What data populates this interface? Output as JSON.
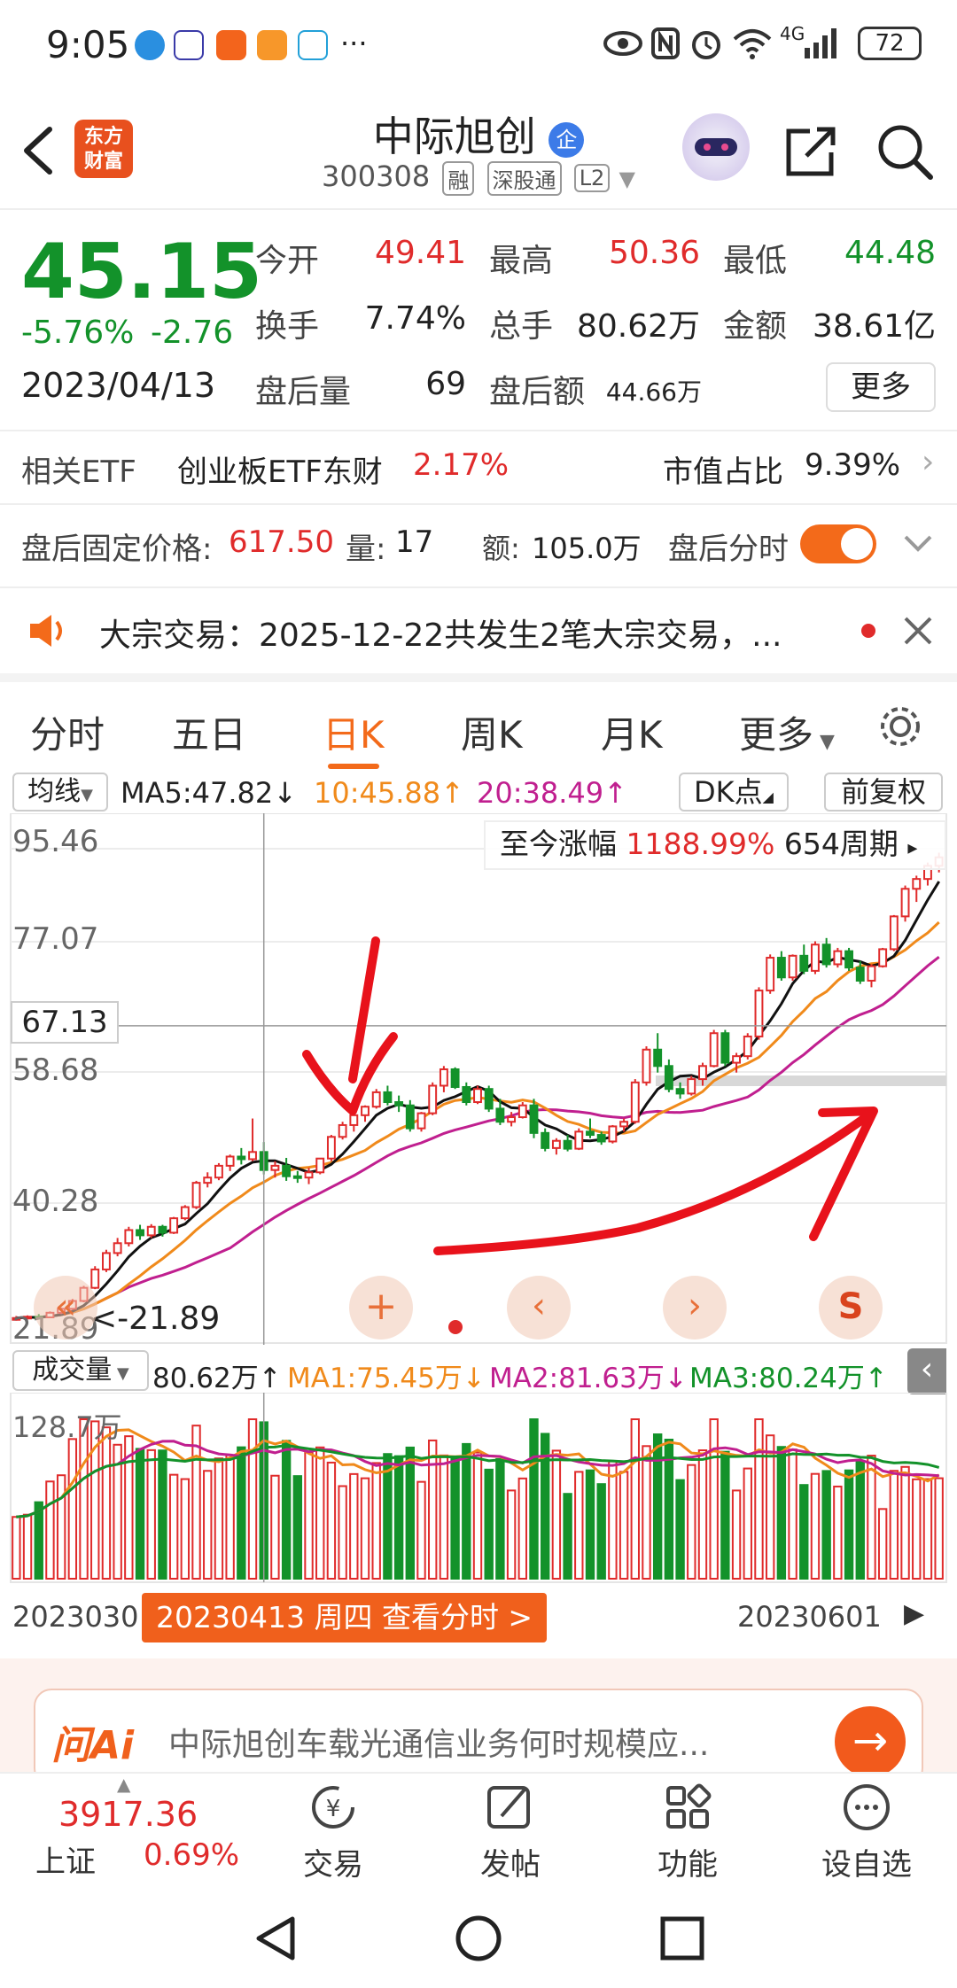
{
  "status_bar": {
    "time": "9:05",
    "more": "···",
    "network": "4G",
    "battery": "72"
  },
  "header": {
    "logo_text_line1": "东方",
    "logo_text_line2": "财富",
    "stock_name": "中际旭创",
    "stock_badge": "企",
    "stock_code": "300308",
    "tags": [
      "融",
      "深股通",
      "L2"
    ]
  },
  "quote": {
    "price": "45.15",
    "change_pct": "-5.76%",
    "change_abs": "-2.76",
    "date": "2023/04/13",
    "fields": [
      {
        "label": "今开",
        "value": "49.41",
        "color": "#e02b2b"
      },
      {
        "label": "最高",
        "value": "50.36",
        "color": "#e02b2b"
      },
      {
        "label": "最低",
        "value": "44.48",
        "color": "#13922a"
      },
      {
        "label": "换手",
        "value": "7.74%",
        "color": "#222222"
      },
      {
        "label": "总手",
        "value": "80.62万",
        "color": "#222222"
      },
      {
        "label": "金额",
        "value": "38.61亿",
        "color": "#222222"
      },
      {
        "label": "盘后量",
        "value": "69",
        "color": "#222222"
      },
      {
        "label": "盘后额",
        "value": "44.66万",
        "color": "#222222"
      }
    ],
    "more_button": "更多"
  },
  "etf": {
    "label": "相关ETF",
    "name": "创业板ETF东财",
    "pct": "2.17%",
    "market_cap_label": "市值占比",
    "market_cap_value": "9.39%"
  },
  "after_hours": {
    "fixed_price_label": "盘后固定价格:",
    "fixed_price": "617.50",
    "volume_label": "量:",
    "volume": "17",
    "amount_label": "额:",
    "amount": "105.0万",
    "timeshare_label": "盘后分时",
    "toggle_on": true
  },
  "notice": {
    "text": "大宗交易：2025-12-22共发生2笔大宗交易，..."
  },
  "tabs": {
    "items": [
      "分时",
      "五日",
      "日K",
      "周K",
      "月K",
      "更多"
    ],
    "active_index": 2
  },
  "ma_row": {
    "selector": "均线",
    "ma5": "MA5:47.82↓",
    "ma10": "10:45.88↑",
    "ma20": "20:38.49↑",
    "dk_button": "DK点",
    "restore_button": "前复权"
  },
  "chart": {
    "y_labels": [
      "95.46",
      "77.07",
      "58.68",
      "40.28",
      "21.89"
    ],
    "crosshair_value": "67.13",
    "low_marker": "21.89",
    "gain_label": "至今涨幅",
    "gain_value": "1188.99%",
    "period": "654周期",
    "colors": {
      "up": "#e02b2b",
      "down": "#13922a",
      "ma5": "#111111",
      "ma10": "#f08a1b",
      "ma20": "#c01f8f",
      "annotation": "#e8121b"
    }
  },
  "volume": {
    "selector": "成交量",
    "vol": "80.62万↑",
    "ma1": "MA1:75.45万↓",
    "ma2": "MA2:81.63万↓",
    "ma3": "MA3:80.24万↑",
    "max_label": "128.7万",
    "date_left": "2023030",
    "date_right": "20230601",
    "cursor_label": "20230413 周四 查看分时 >"
  },
  "chart_data": {
    "type": "candlestick",
    "title": "中际旭创 日K",
    "ylim": [
      21.89,
      95.46
    ],
    "ohlc": [
      [
        22.5,
        22.9,
        22.2,
        22.6
      ],
      [
        22.6,
        23.0,
        22.4,
        22.8
      ],
      [
        22.8,
        23.2,
        22.5,
        22.7
      ],
      [
        22.7,
        23.6,
        22.6,
        23.4
      ],
      [
        23.4,
        24.2,
        23.2,
        24.0
      ],
      [
        24.0,
        25.5,
        23.8,
        25.2
      ],
      [
        25.2,
        27.5,
        25.0,
        27.2
      ],
      [
        27.2,
        30.5,
        27.0,
        30.0
      ],
      [
        30.0,
        33.0,
        29.6,
        32.5
      ],
      [
        32.5,
        34.8,
        32.0,
        34.0
      ],
      [
        34.0,
        36.5,
        33.5,
        36.0
      ],
      [
        36.0,
        36.8,
        34.5,
        35.2
      ],
      [
        35.2,
        36.9,
        34.8,
        36.5
      ],
      [
        36.5,
        36.8,
        35.0,
        35.6
      ],
      [
        35.6,
        38.0,
        35.4,
        37.8
      ],
      [
        37.8,
        39.8,
        37.5,
        39.5
      ],
      [
        39.5,
        43.5,
        39.2,
        43.2
      ],
      [
        43.2,
        44.8,
        42.5,
        44.0
      ],
      [
        44.0,
        46.2,
        43.6,
        45.8
      ],
      [
        45.8,
        47.5,
        45.0,
        47.2
      ],
      [
        47.2,
        48.5,
        46.0,
        46.8
      ],
      [
        46.8,
        53.0,
        46.5,
        47.9
      ],
      [
        47.9,
        49.41,
        44.48,
        45.15
      ],
      [
        45.15,
        46.5,
        44.0,
        45.8
      ],
      [
        45.8,
        47.0,
        43.5,
        44.2
      ],
      [
        44.2,
        45.0,
        43.2,
        44.0
      ],
      [
        44.0,
        45.5,
        43.0,
        44.8
      ],
      [
        44.8,
        47.0,
        44.5,
        46.9
      ],
      [
        46.9,
        50.5,
        46.5,
        50.2
      ],
      [
        50.2,
        52.5,
        49.8,
        52.0
      ],
      [
        52.0,
        54.0,
        51.0,
        53.5
      ],
      [
        53.5,
        55.0,
        52.5,
        54.8
      ],
      [
        54.8,
        57.5,
        54.5,
        57.0
      ],
      [
        57.0,
        58.0,
        55.0,
        55.5
      ],
      [
        55.5,
        56.5,
        54.0,
        55.0
      ],
      [
        55.0,
        55.8,
        51.0,
        51.5
      ],
      [
        51.5,
        54.0,
        51.0,
        53.8
      ],
      [
        53.8,
        58.5,
        53.5,
        58.0
      ],
      [
        58.0,
        61.0,
        57.0,
        60.5
      ],
      [
        60.5,
        60.8,
        57.5,
        57.8
      ],
      [
        57.8,
        58.5,
        55.0,
        55.5
      ],
      [
        55.5,
        58.0,
        55.2,
        57.5
      ],
      [
        57.5,
        58.0,
        54.0,
        54.5
      ],
      [
        54.5,
        56.0,
        52.0,
        52.5
      ],
      [
        52.5,
        54.0,
        51.8,
        53.2
      ],
      [
        53.2,
        55.5,
        53.0,
        55.0
      ],
      [
        55.0,
        56.0,
        50.0,
        50.8
      ],
      [
        50.8,
        51.5,
        48.0,
        48.5
      ],
      [
        48.5,
        50.0,
        47.5,
        49.6
      ],
      [
        49.6,
        50.5,
        48.0,
        48.4
      ],
      [
        48.4,
        51.5,
        48.2,
        51.0
      ],
      [
        51.0,
        53.0,
        50.0,
        50.5
      ],
      [
        50.5,
        51.0,
        49.0,
        49.5
      ],
      [
        49.5,
        52.0,
        49.2,
        51.8
      ],
      [
        51.8,
        53.0,
        51.0,
        52.5
      ],
      [
        52.5,
        59.0,
        52.2,
        58.5
      ],
      [
        58.5,
        64.0,
        58.0,
        63.5
      ],
      [
        63.5,
        66.0,
        60.0,
        61.0
      ],
      [
        61.0,
        62.0,
        57.0,
        57.5
      ],
      [
        57.5,
        58.5,
        56.0,
        56.8
      ],
      [
        56.8,
        59.5,
        56.5,
        59.0
      ],
      [
        59.0,
        61.5,
        58.0,
        61.0
      ],
      [
        61.0,
        66.5,
        60.8,
        66.0
      ],
      [
        66.0,
        66.5,
        61.0,
        61.5
      ],
      [
        61.5,
        63.0,
        60.0,
        62.5
      ],
      [
        62.5,
        66.0,
        62.0,
        65.5
      ],
      [
        65.5,
        73.0,
        65.0,
        72.5
      ],
      [
        72.5,
        78.0,
        72.0,
        77.5
      ],
      [
        77.5,
        78.5,
        74.0,
        74.5
      ],
      [
        74.5,
        78.0,
        74.0,
        77.8
      ],
      [
        77.8,
        79.5,
        75.0,
        75.5
      ],
      [
        75.5,
        80.0,
        75.0,
        79.5
      ],
      [
        79.5,
        80.5,
        76.0,
        76.5
      ],
      [
        76.5,
        79.0,
        76.0,
        78.5
      ],
      [
        78.5,
        79.0,
        75.5,
        76.0
      ],
      [
        76.0,
        77.0,
        73.5,
        74.0
      ],
      [
        74.0,
        76.5,
        73.0,
        76.2
      ],
      [
        76.2,
        79.0,
        76.0,
        78.8
      ],
      [
        78.8,
        84.0,
        78.5,
        83.8
      ],
      [
        83.8,
        88.5,
        83.0,
        88.0
      ],
      [
        88.0,
        90.0,
        86.0,
        89.5
      ],
      [
        89.5,
        92.0,
        88.5,
        91.5
      ],
      [
        91.5,
        93.5,
        90.5,
        92.8
      ]
    ],
    "cursor_index": 22,
    "volume_ylim": [
      0,
      128.7
    ]
  },
  "ai_bar": {
    "logo": "问Ai",
    "text": "中际旭创车载光通信业务何时规模应..."
  },
  "bottom_nav": {
    "index_value": "3917.36",
    "index_name": "上证",
    "index_pct": "0.69%",
    "items": [
      "交易",
      "发帖",
      "功能",
      "设自选"
    ]
  }
}
